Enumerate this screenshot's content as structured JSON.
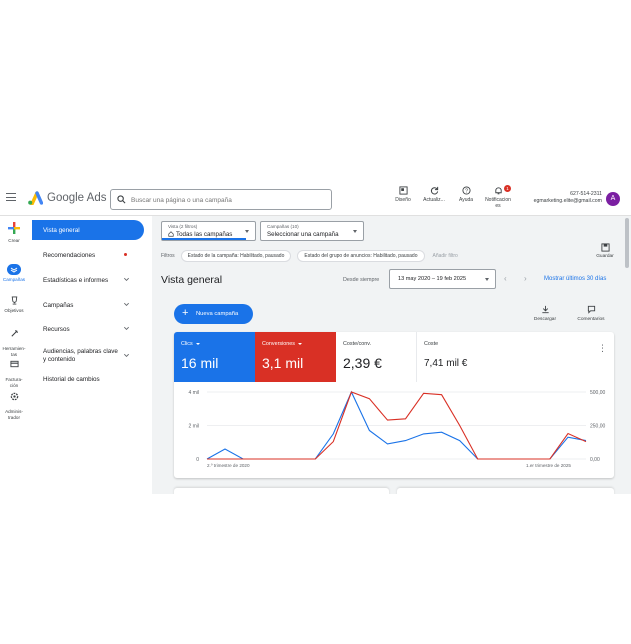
{
  "brand": "Google Ads",
  "colors": {
    "accent": "#1a73e8",
    "conversions": "#d93025",
    "avatar": "#7b1fa2"
  },
  "search": {
    "placeholder": "Buscar una página o una campaña",
    "icon": "search-icon"
  },
  "toolbar": [
    {
      "label": "Diseño",
      "icon": "layout-icon"
    },
    {
      "label": "Actualiz...",
      "icon": "refresh-icon"
    },
    {
      "label": "Ayuda",
      "icon": "help-icon"
    },
    {
      "label": "Notificacion\nes",
      "icon": "bell-icon",
      "badge": "1"
    }
  ],
  "account": {
    "id": "627-514-2311",
    "email": "egmarketing.elite@gmail.com",
    "avatar_letter": "A"
  },
  "rail": [
    {
      "label": "Crear",
      "icon": "create-plus-icon"
    },
    {
      "label": "Campañas",
      "icon": "campaigns-icon",
      "active": true
    },
    {
      "label": "Objetivos",
      "icon": "goals-trophy-icon"
    },
    {
      "label": "Herramien-\ntas",
      "icon": "tools-icon"
    },
    {
      "label": "Factura-\nción",
      "icon": "billing-icon"
    },
    {
      "label": "Adminis-\ntrador",
      "icon": "admin-gear-icon"
    }
  ],
  "nav": [
    {
      "label": "Vista general",
      "active": true
    },
    {
      "label": "Recomendaciones",
      "dot": true
    },
    {
      "label": "Estadísticas e informes",
      "chevron": true
    },
    {
      "label": "Campañas",
      "chevron": true
    },
    {
      "label": "Recursos",
      "chevron": true
    },
    {
      "label": "Audiencias, palabras clave\ny contenido",
      "chevron": true
    },
    {
      "label": "Historial de cambios"
    }
  ],
  "view_filter": {
    "small": "Vista (2 filtros)",
    "value": "Todas las campañas"
  },
  "campaign_filter": {
    "small": "Campañas (10)",
    "value": "Seleccionar una campaña"
  },
  "save_label": "Guardar",
  "filters": {
    "label": "Filtros",
    "chips": [
      "Estado de la campaña: Habilitado, pausado",
      "Estado del grupo de anuncios: Habilitado, pausado"
    ],
    "add": "Añadir filtro"
  },
  "page_title": "Vista general",
  "date": {
    "label": "Desde siempre",
    "range": "13 may 2020 – 19 feb 2025",
    "last": "Mostrar últimos 30 días"
  },
  "new_campaign": "Nueva campaña",
  "tools": {
    "download": "Descargar",
    "comments": "Comentarios"
  },
  "metrics": [
    {
      "label": "Clics",
      "value": "16 mil",
      "style": "blue",
      "dropdown": true
    },
    {
      "label": "Conversiones",
      "value": "3,1 mil",
      "style": "red",
      "dropdown": true
    },
    {
      "label": "Coste/conv.",
      "value": "2,39 €",
      "style": "plain"
    },
    {
      "label": "Coste",
      "value": "7,41 mil €",
      "style": "plain"
    }
  ],
  "chart_data": {
    "type": "line",
    "x_labels": [
      "2.º trimestre de 2020",
      "1.er trimestre de 2025"
    ],
    "left_axis": {
      "ticks": [
        "0",
        "2 mil",
        "4 mil"
      ],
      "max": 4000
    },
    "right_axis": {
      "ticks": [
        "0,00",
        "250,00",
        "500,00"
      ],
      "max": 500
    },
    "series": [
      {
        "axis": "left",
        "color": "#1a73e8",
        "values": [
          0,
          600,
          0,
          0,
          0,
          0,
          0,
          1500,
          4000,
          1700,
          900,
          1100,
          1500,
          1600,
          1100,
          0,
          0,
          0,
          0,
          0,
          1300,
          1100
        ]
      },
      {
        "axis": "right",
        "color": "#d93025",
        "values": [
          0,
          0,
          0,
          0,
          0,
          0,
          0,
          130,
          500,
          450,
          290,
          300,
          490,
          480,
          250,
          0,
          0,
          0,
          0,
          0,
          190,
          130
        ]
      }
    ]
  }
}
